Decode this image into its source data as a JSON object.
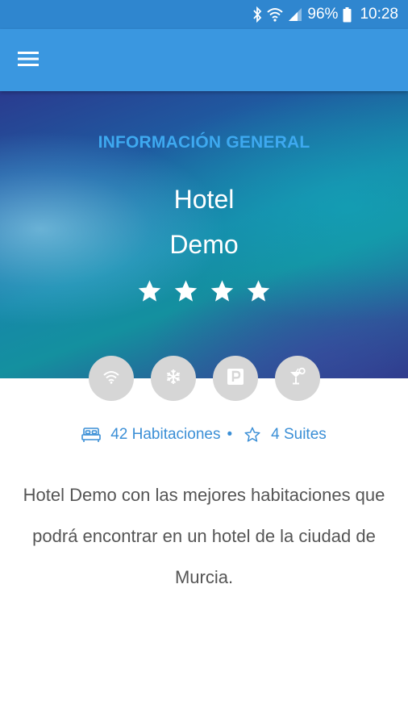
{
  "status_bar": {
    "battery_percent": "96%",
    "time": "10:28",
    "icons": [
      "bluetooth-icon",
      "wifi-icon",
      "signal-icon",
      "battery-icon"
    ]
  },
  "app_bar": {
    "menu_icon": "hamburger-menu-icon",
    "color": "#3a97e0"
  },
  "hero": {
    "section_title": "INFORMACIÓN GENERAL",
    "hotel_name_line1": "Hotel",
    "hotel_name_line2": "Demo",
    "star_rating": 4,
    "accent_color": "#3ea9f0"
  },
  "amenities": [
    {
      "icon": "wifi-icon"
    },
    {
      "icon": "snowflake-icon"
    },
    {
      "icon": "parking-icon"
    },
    {
      "icon": "cocktail-icon"
    }
  ],
  "room_info": {
    "rooms_label": "42 Habitaciones",
    "separator": "•",
    "suites_label": "4 Suites",
    "color": "#3b8fd6"
  },
  "description": {
    "text": "Hotel Demo con las mejores habitaciones que podrá encontrar en un hotel de la ciudad de Murcia."
  }
}
